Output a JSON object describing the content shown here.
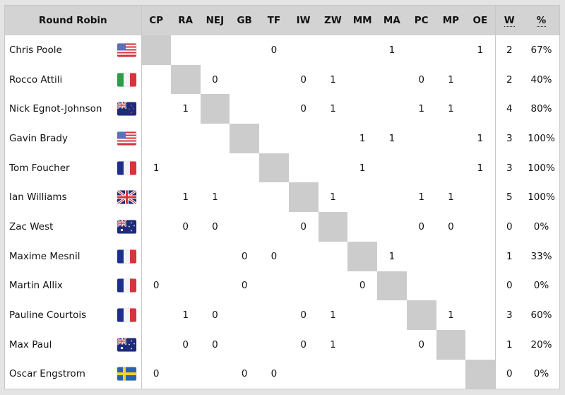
{
  "table": {
    "title": "Round Robin",
    "columns": [
      "CP",
      "RA",
      "NEJ",
      "GB",
      "TF",
      "IW",
      "ZW",
      "MM",
      "MA",
      "PC",
      "MP",
      "OE"
    ],
    "wins_header": "W",
    "pct_header": "%",
    "diagonal_color": "#cccccc",
    "header_color": "#d3d3d3",
    "rows": [
      {
        "name": "Chris Poole",
        "flag": "usa-flag-icon",
        "results": [
          "",
          "",
          "",
          "",
          "0",
          "",
          "",
          "",
          "1",
          "",
          "",
          "1"
        ],
        "wins": "2",
        "pct": "67%"
      },
      {
        "name": "Rocco Attili",
        "flag": "italy-flag-icon",
        "results": [
          "",
          "",
          "0",
          "",
          "",
          "0",
          "1",
          "",
          "",
          "0",
          "1",
          ""
        ],
        "wins": "2",
        "pct": "40%"
      },
      {
        "name": "Nick Egnot-Johnson",
        "flag": "new-zealand-flag-icon",
        "results": [
          "",
          "1",
          "",
          "",
          "",
          "0",
          "1",
          "",
          "",
          "1",
          "1",
          ""
        ],
        "wins": "4",
        "pct": "80%"
      },
      {
        "name": "Gavin Brady",
        "flag": "usa-flag-icon",
        "results": [
          "",
          "",
          "",
          "",
          "",
          "",
          "",
          "1",
          "1",
          "",
          "",
          "1"
        ],
        "wins": "3",
        "pct": "100%"
      },
      {
        "name": "Tom Foucher",
        "flag": "france-flag-icon",
        "results": [
          "1",
          "",
          "",
          "",
          "",
          "",
          "",
          "1",
          "",
          "",
          "",
          "1"
        ],
        "wins": "3",
        "pct": "100%"
      },
      {
        "name": "Ian Williams",
        "flag": "uk-flag-icon",
        "results": [
          "",
          "1",
          "1",
          "",
          "",
          "",
          "1",
          "",
          "",
          "1",
          "1",
          ""
        ],
        "wins": "5",
        "pct": "100%"
      },
      {
        "name": "Zac West",
        "flag": "australia-flag-icon",
        "results": [
          "",
          "0",
          "0",
          "",
          "",
          "0",
          "",
          "",
          "",
          "0",
          "0",
          ""
        ],
        "wins": "0",
        "pct": "0%"
      },
      {
        "name": "Maxime Mesnil",
        "flag": "france-flag-icon",
        "results": [
          "",
          "",
          "",
          "0",
          "0",
          "",
          "",
          "",
          "1",
          "",
          "",
          ""
        ],
        "wins": "1",
        "pct": "33%"
      },
      {
        "name": "Martin Allix",
        "flag": "france-flag-icon",
        "results": [
          "0",
          "",
          "",
          "0",
          "",
          "",
          "",
          "0",
          "",
          "",
          "",
          ""
        ],
        "wins": "0",
        "pct": "0%"
      },
      {
        "name": "Pauline Courtois",
        "flag": "france-flag-icon",
        "results": [
          "",
          "1",
          "0",
          "",
          "",
          "0",
          "1",
          "",
          "",
          "",
          "1",
          ""
        ],
        "wins": "3",
        "pct": "60%"
      },
      {
        "name": "Max Paul",
        "flag": "australia-flag-icon",
        "results": [
          "",
          "0",
          "0",
          "",
          "",
          "0",
          "1",
          "",
          "",
          "0",
          "",
          ""
        ],
        "wins": "1",
        "pct": "20%"
      },
      {
        "name": "Oscar Engstrom",
        "flag": "sweden-flag-icon",
        "results": [
          "0",
          "",
          "",
          "0",
          "0",
          "",
          "",
          "",
          "",
          "",
          "",
          ""
        ],
        "wins": "0",
        "pct": "0%"
      }
    ]
  }
}
